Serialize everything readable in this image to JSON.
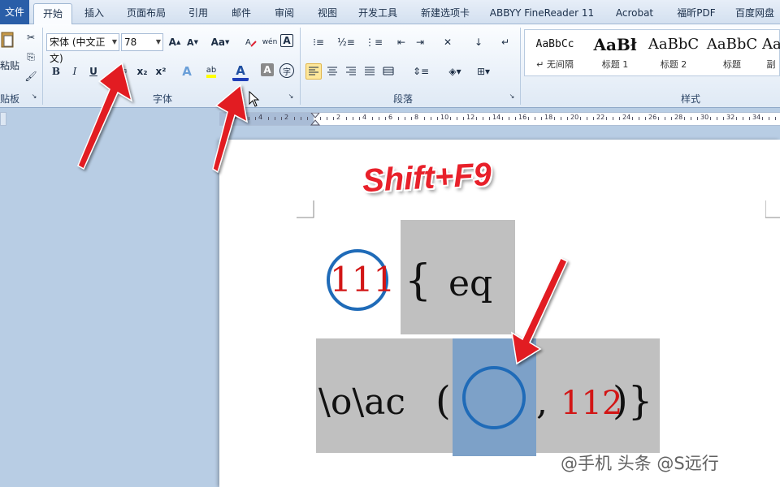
{
  "tabs": [
    {
      "label": "文件",
      "name": "tab-file"
    },
    {
      "label": "开始",
      "name": "tab-home"
    },
    {
      "label": "插入",
      "name": "tab-insert"
    },
    {
      "label": "页面布局",
      "name": "tab-page-layout"
    },
    {
      "label": "引用",
      "name": "tab-references"
    },
    {
      "label": "邮件",
      "name": "tab-mailings"
    },
    {
      "label": "审阅",
      "name": "tab-review"
    },
    {
      "label": "视图",
      "name": "tab-view"
    },
    {
      "label": "开发工具",
      "name": "tab-developer"
    },
    {
      "label": "新建选项卡",
      "name": "tab-new-tab"
    },
    {
      "label": "ABBYY FineReader 11",
      "name": "tab-abbyy"
    },
    {
      "label": "Acrobat",
      "name": "tab-acrobat"
    },
    {
      "label": "福昕PDF",
      "name": "tab-foxit-pdf"
    },
    {
      "label": "百度网盘",
      "name": "tab-baidu-netdisk"
    }
  ],
  "clipboard": {
    "paste_label": "粘贴",
    "group_label": "贴板"
  },
  "font": {
    "font_name": "宋体 (中文正文)",
    "font_size": "78",
    "group_label": "字体",
    "bold": "B",
    "italic": "I",
    "underline": "U",
    "strike": "abc",
    "subscript": "x₂",
    "superscript": "x²",
    "grow": "A",
    "shrink": "A",
    "change_case": "Aa",
    "char_border": "A",
    "enclose": "字",
    "font_color": "A",
    "text_effect": "A",
    "highlight": "ab"
  },
  "paragraph": {
    "group_label": "段落"
  },
  "styles": {
    "group_label": "样式",
    "items": [
      {
        "sample": "AaBbCc",
        "name": "↵ 无间隔"
      },
      {
        "sample": "AaBł",
        "name": "标题 1"
      },
      {
        "sample": "AaBbC",
        "name": "标题 2"
      },
      {
        "sample": "AaBbC",
        "name": "标题"
      },
      {
        "sample": "Aa",
        "name": "副"
      }
    ]
  },
  "ruler": {
    "numbers": [
      "6",
      "4",
      "2",
      "",
      "2",
      "4",
      "6",
      "8",
      "10",
      "12",
      "14",
      "16",
      "18",
      "20",
      "22",
      "24",
      "26",
      "28",
      "30",
      "32",
      "34"
    ]
  },
  "document": {
    "annotation": "Shift+F9",
    "line1": {
      "circled_number": "111",
      "open_brace": "{",
      "keyword": "eq"
    },
    "line2": {
      "code": "\\o\\ac",
      "open_paren": "(",
      "comma": ",",
      "number": "112",
      "close": ")}"
    }
  },
  "watermark": "头条 @S远行",
  "watermark_prefix": "@手机",
  "colors": {
    "accent_blue": "#1f6bb8",
    "annotation_red": "#e8202a",
    "highlight_yellow": "#fde79a",
    "field_shading": "#c0c0c0"
  }
}
